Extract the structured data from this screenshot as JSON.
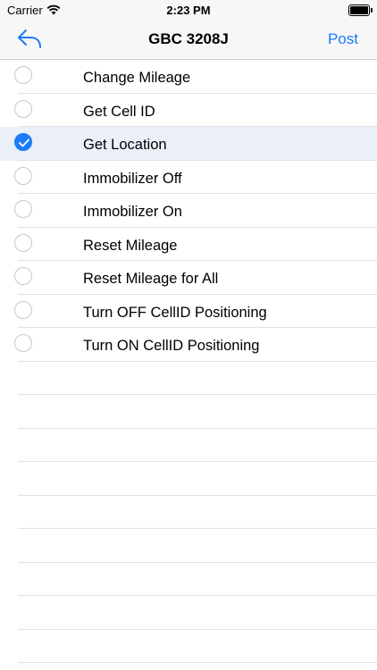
{
  "status": {
    "carrier": "Carrier",
    "time": "2:23 PM",
    "icons": [
      "wifi-icon",
      "battery-icon"
    ]
  },
  "nav": {
    "title": "GBC 3208J",
    "post_label": "Post",
    "back_icon": "reply-back-icon"
  },
  "accent": "#1b7cf5",
  "commands": [
    {
      "label": "Change Mileage",
      "selected": false
    },
    {
      "label": "Get Cell ID",
      "selected": false
    },
    {
      "label": "Get Location",
      "selected": true
    },
    {
      "label": "Immobilizer Off",
      "selected": false
    },
    {
      "label": "Immobilizer On",
      "selected": false
    },
    {
      "label": "Reset Mileage",
      "selected": false
    },
    {
      "label": "Reset Mileage for All",
      "selected": false
    },
    {
      "label": "Turn OFF CellID Positioning",
      "selected": false
    },
    {
      "label": "Turn ON CellID Positioning",
      "selected": false
    }
  ]
}
